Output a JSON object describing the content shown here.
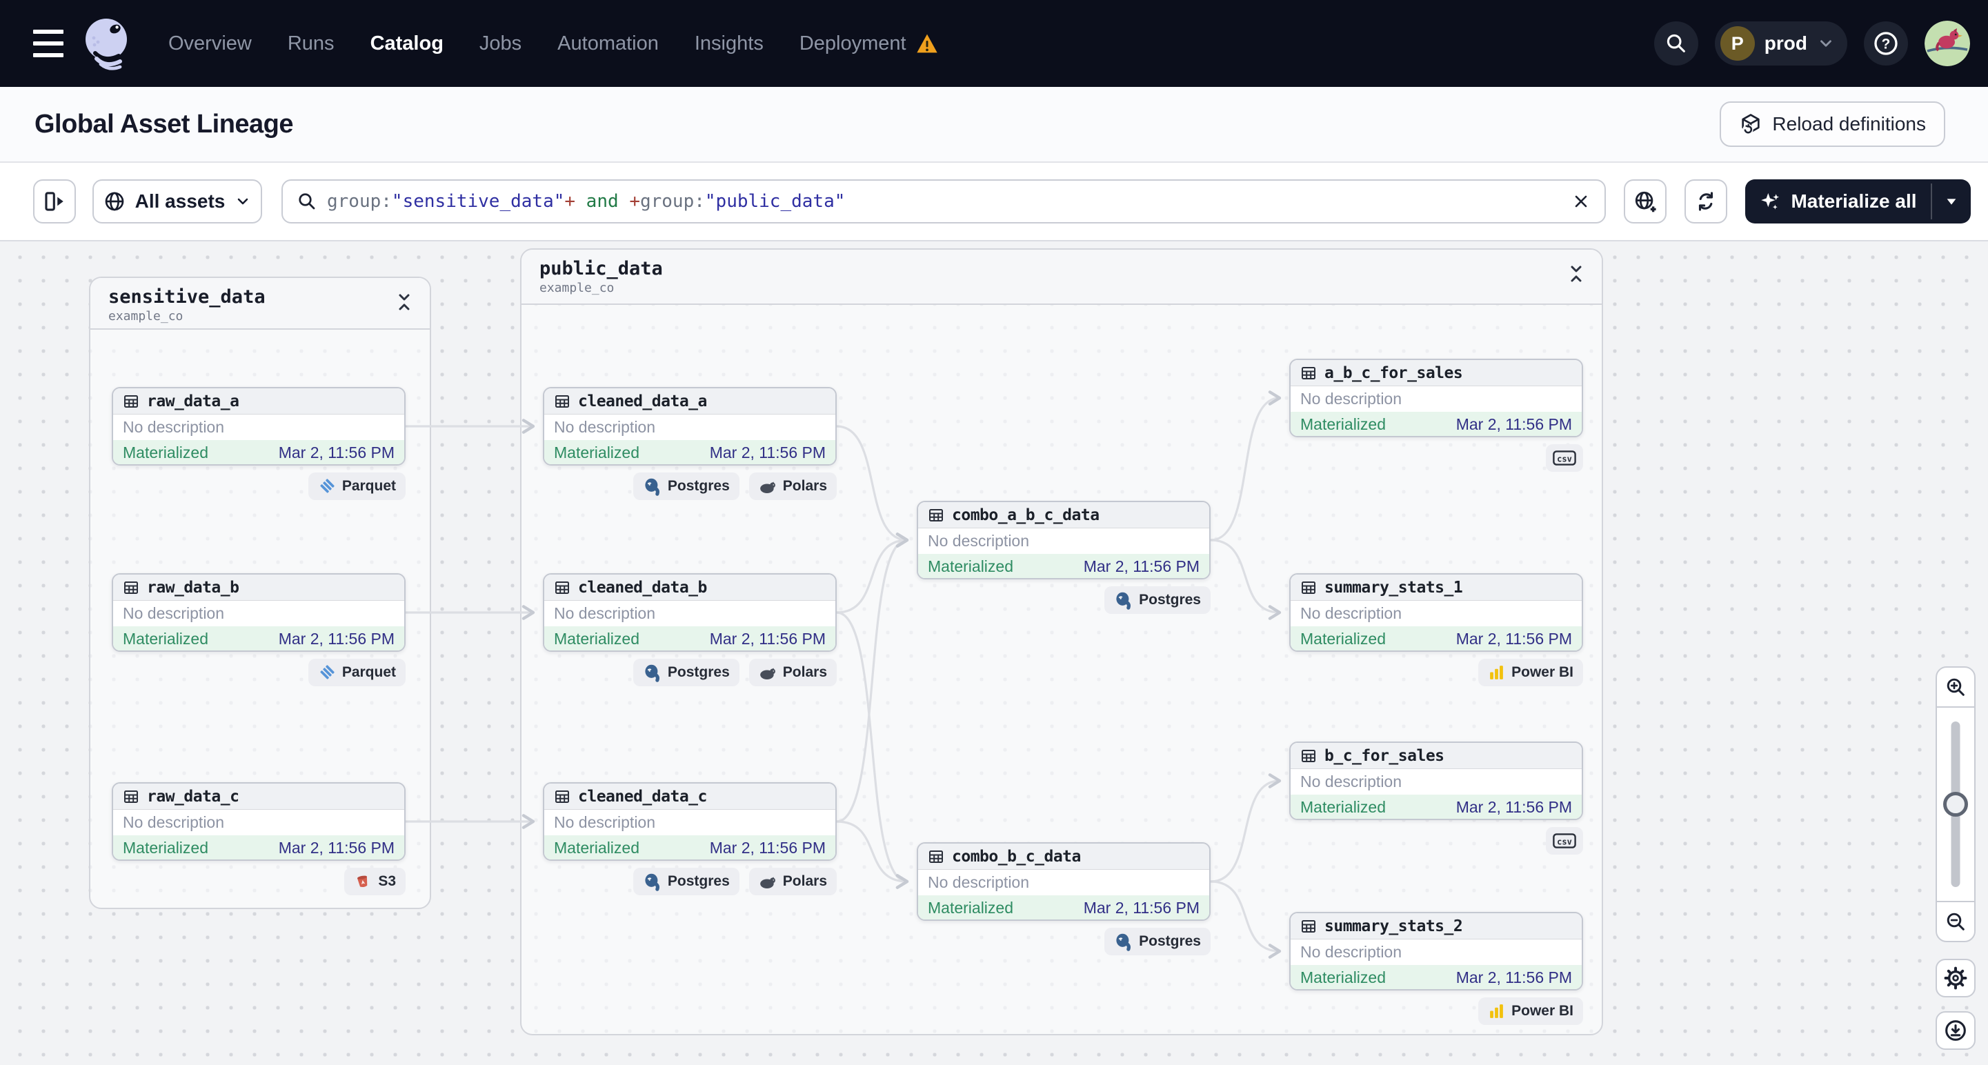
{
  "nav": {
    "items": [
      {
        "label": "Overview"
      },
      {
        "label": "Runs"
      },
      {
        "label": "Catalog",
        "active": true
      },
      {
        "label": "Jobs"
      },
      {
        "label": "Automation"
      },
      {
        "label": "Insights"
      },
      {
        "label": "Deployment",
        "warning": true
      }
    ],
    "deployment_switcher": {
      "initial": "P",
      "label": "prod"
    }
  },
  "header": {
    "title": "Global Asset Lineage",
    "reload_button": "Reload definitions"
  },
  "toolbar": {
    "asset_filter": {
      "label": "All assets"
    },
    "search": {
      "segments": [
        {
          "text": "group:",
          "kind": "key"
        },
        {
          "text": "\"sensitive_data\"",
          "kind": "string"
        },
        {
          "text": "+",
          "kind": "op"
        },
        {
          "text": " and ",
          "kind": "keyword"
        },
        {
          "text": "+",
          "kind": "op"
        },
        {
          "text": "group:",
          "kind": "key"
        },
        {
          "text": "\"public_data\"",
          "kind": "string"
        }
      ]
    },
    "materialize_button": "Materialize all"
  },
  "canvas": {
    "groups": [
      {
        "name": "sensitive_data",
        "subtitle": "example_co"
      },
      {
        "name": "public_data",
        "subtitle": "example_co"
      }
    ],
    "shared": {
      "desc": "No description",
      "status": "Materialized",
      "time": "Mar 2, 11:56 PM"
    },
    "nodes": [
      {
        "name": "raw_data_a",
        "desc": "No description",
        "status": "Materialized",
        "time": "Mar 2, 11:56 PM",
        "badges": [
          {
            "label": "Parquet",
            "icon": "parquet-icon"
          }
        ]
      },
      {
        "name": "raw_data_b",
        "desc": "No description",
        "status": "Materialized",
        "time": "Mar 2, 11:56 PM",
        "badges": [
          {
            "label": "Parquet",
            "icon": "parquet-icon"
          }
        ]
      },
      {
        "name": "raw_data_c",
        "desc": "No description",
        "status": "Materialized",
        "time": "Mar 2, 11:56 PM",
        "badges": [
          {
            "label": "S3",
            "icon": "s3-icon"
          }
        ]
      },
      {
        "name": "cleaned_data_a",
        "desc": "No description",
        "status": "Materialized",
        "time": "Mar 2, 11:56 PM",
        "badges": [
          {
            "label": "Postgres",
            "icon": "postgres-icon"
          },
          {
            "label": "Polars",
            "icon": "polars-icon"
          }
        ]
      },
      {
        "name": "cleaned_data_b",
        "desc": "No description",
        "status": "Materialized",
        "time": "Mar 2, 11:56 PM",
        "badges": [
          {
            "label": "Postgres",
            "icon": "postgres-icon"
          },
          {
            "label": "Polars",
            "icon": "polars-icon"
          }
        ]
      },
      {
        "name": "cleaned_data_c",
        "desc": "No description",
        "status": "Materialized",
        "time": "Mar 2, 11:56 PM",
        "badges": [
          {
            "label": "Postgres",
            "icon": "postgres-icon"
          },
          {
            "label": "Polars",
            "icon": "polars-icon"
          }
        ]
      },
      {
        "name": "combo_a_b_c_data",
        "desc": "No description",
        "status": "Materialized",
        "time": "Mar 2, 11:56 PM",
        "badges": [
          {
            "label": "Postgres",
            "icon": "postgres-icon"
          }
        ]
      },
      {
        "name": "combo_b_c_data",
        "desc": "No description",
        "status": "Materialized",
        "time": "Mar 2, 11:56 PM",
        "badges": [
          {
            "label": "Postgres",
            "icon": "postgres-icon"
          }
        ]
      },
      {
        "name": "a_b_c_for_sales",
        "desc": "No description",
        "status": "Materialized",
        "time": "Mar 2, 11:56 PM",
        "badges": [
          {
            "label": "",
            "icon": "csv-icon",
            "icon_text": "csv"
          }
        ]
      },
      {
        "name": "summary_stats_1",
        "desc": "No description",
        "status": "Materialized",
        "time": "Mar 2, 11:56 PM",
        "badges": [
          {
            "label": "Power BI",
            "icon": "powerbi-icon"
          }
        ]
      },
      {
        "name": "b_c_for_sales",
        "desc": "No description",
        "status": "Materialized",
        "time": "Mar 2, 11:56 PM",
        "badges": [
          {
            "label": "",
            "icon": "csv-icon",
            "icon_text": "csv"
          }
        ]
      },
      {
        "name": "summary_stats_2",
        "desc": "No description",
        "status": "Materialized",
        "time": "Mar 2, 11:56 PM",
        "badges": [
          {
            "label": "Power BI",
            "icon": "powerbi-icon"
          }
        ]
      }
    ],
    "edges": [
      [
        "raw_data_a",
        "cleaned_data_a"
      ],
      [
        "raw_data_b",
        "cleaned_data_b"
      ],
      [
        "raw_data_c",
        "cleaned_data_c"
      ],
      [
        "cleaned_data_a",
        "combo_a_b_c_data"
      ],
      [
        "cleaned_data_b",
        "combo_a_b_c_data"
      ],
      [
        "cleaned_data_c",
        "combo_a_b_c_data"
      ],
      [
        "cleaned_data_b",
        "combo_b_c_data"
      ],
      [
        "cleaned_data_c",
        "combo_b_c_data"
      ],
      [
        "combo_a_b_c_data",
        "a_b_c_for_sales"
      ],
      [
        "combo_a_b_c_data",
        "summary_stats_1"
      ],
      [
        "combo_b_c_data",
        "b_c_for_sales"
      ],
      [
        "combo_b_c_data",
        "summary_stats_2"
      ]
    ]
  },
  "colors": {
    "nav_bg": "#0b0e1b",
    "materialized_text": "#2e8c62",
    "materialized_bg": "#e7f5ec",
    "timestamp": "#312f86",
    "warning": "#f0a01d",
    "edge": "#dcdee3"
  }
}
